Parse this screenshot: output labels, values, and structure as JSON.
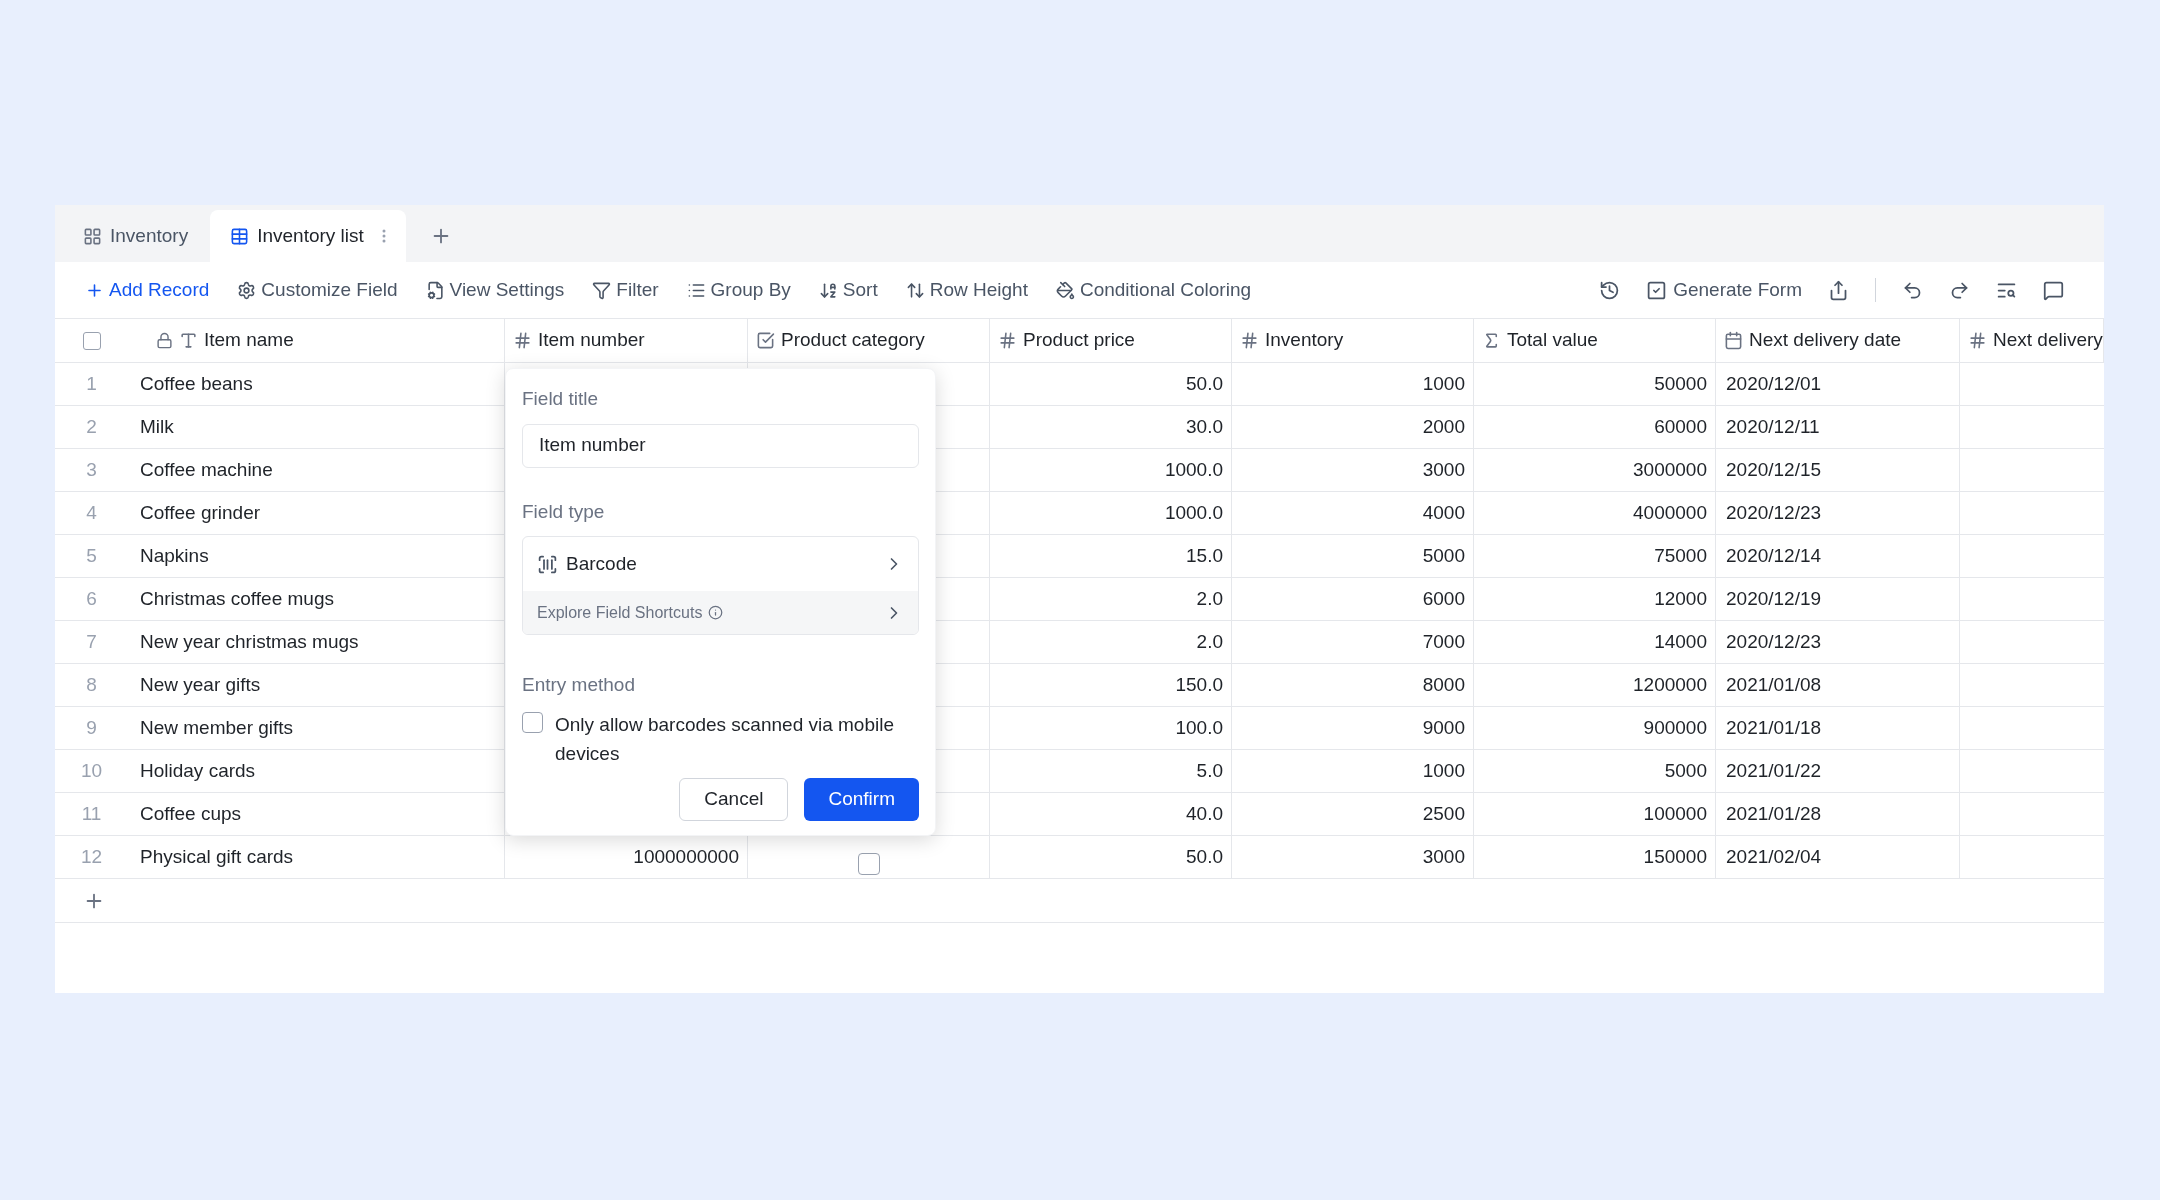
{
  "tabs": [
    {
      "label": "Inventory",
      "kind": "grid",
      "selected": false
    },
    {
      "label": "Inventory list",
      "kind": "table",
      "selected": true
    }
  ],
  "toolbar": [
    {
      "label": "Add Record",
      "kind": "add"
    },
    {
      "label": "Customize Field",
      "kind": "gear"
    },
    {
      "label": "View Settings",
      "kind": "view"
    },
    {
      "label": "Filter",
      "kind": "filter"
    },
    {
      "label": "Group By",
      "kind": "group"
    },
    {
      "label": "Sort",
      "kind": "sort"
    },
    {
      "label": "Row Height",
      "kind": "height"
    },
    {
      "label": "Conditional Coloring",
      "kind": "paint"
    }
  ],
  "toolbar_right": [
    {
      "kind": "history"
    },
    {
      "kind": "form",
      "label": "Generate Form"
    },
    {
      "kind": "share"
    },
    {
      "kind": "undo"
    },
    {
      "kind": "redo"
    },
    {
      "kind": "find"
    },
    {
      "kind": "comment"
    }
  ],
  "table": {
    "select_all_checked": false,
    "columns": [
      {
        "label": "Item name",
        "kind": "text"
      },
      {
        "label": "Item number",
        "kind": "number"
      },
      {
        "label": "Product category",
        "kind": "checkbox"
      },
      {
        "label": "Product price",
        "kind": "number"
      },
      {
        "label": "Inventory",
        "kind": "number"
      },
      {
        "label": "Total value",
        "kind": "formula"
      },
      {
        "label": "Next delivery date",
        "kind": "date"
      },
      {
        "label": "Next delivery",
        "kind": "number"
      }
    ],
    "rows": [
      {
        "index": "1",
        "name": "Coffee beans",
        "price": "50.0",
        "inventory": "1000",
        "total": "50000",
        "date": "2020/12/01"
      },
      {
        "index": "2",
        "name": "Milk",
        "price": "30.0",
        "inventory": "2000",
        "total": "60000",
        "date": "2020/12/11"
      },
      {
        "index": "3",
        "name": "Coffee machine",
        "price": "1000.0",
        "inventory": "3000",
        "total": "3000000",
        "date": "2020/12/15"
      },
      {
        "index": "4",
        "name": "Coffee grinder",
        "price": "1000.0",
        "inventory": "4000",
        "total": "4000000",
        "date": "2020/12/23"
      },
      {
        "index": "5",
        "name": "Napkins",
        "price": "15.0",
        "inventory": "5000",
        "total": "75000",
        "date": "2020/12/14"
      },
      {
        "index": "6",
        "name": "Christmas coffee mugs",
        "price": "2.0",
        "inventory": "6000",
        "total": "12000",
        "date": "2020/12/19"
      },
      {
        "index": "7",
        "name": "New year christmas mugs",
        "price": "2.0",
        "inventory": "7000",
        "total": "14000",
        "date": "2020/12/23"
      },
      {
        "index": "8",
        "name": "New year gifts",
        "price": "150.0",
        "inventory": "8000",
        "total": "1200000",
        "date": "2021/01/08"
      },
      {
        "index": "9",
        "name": "New member gifts",
        "price": "100.0",
        "inventory": "9000",
        "total": "900000",
        "date": "2021/01/18"
      },
      {
        "index": "10",
        "name": "Holiday cards",
        "price": "5.0",
        "inventory": "1000",
        "total": "5000",
        "date": "2021/01/22"
      },
      {
        "index": "11",
        "name": "Coffee cups",
        "price": "40.0",
        "inventory": "2500",
        "total": "100000",
        "date": "2021/01/28"
      },
      {
        "index": "12",
        "name": "Physical gift cards",
        "item_number": "1000000000",
        "category_checked": false,
        "price": "50.0",
        "inventory": "3000",
        "total": "150000",
        "date": "2021/02/04"
      }
    ]
  },
  "field_popup": {
    "title_label": "Field title",
    "title_value": "Item number",
    "type_label": "Field type",
    "type_value": "Barcode",
    "shortcuts": "Explore Field Shortcuts",
    "entry_label": "Entry method",
    "entry_option": {
      "label": "Only allow barcodes scanned via mobile devices",
      "checked": false
    },
    "buttons": [
      {
        "label": "Cancel",
        "kind": "secondary"
      },
      {
        "label": "Confirm",
        "kind": "primary"
      }
    ]
  }
}
